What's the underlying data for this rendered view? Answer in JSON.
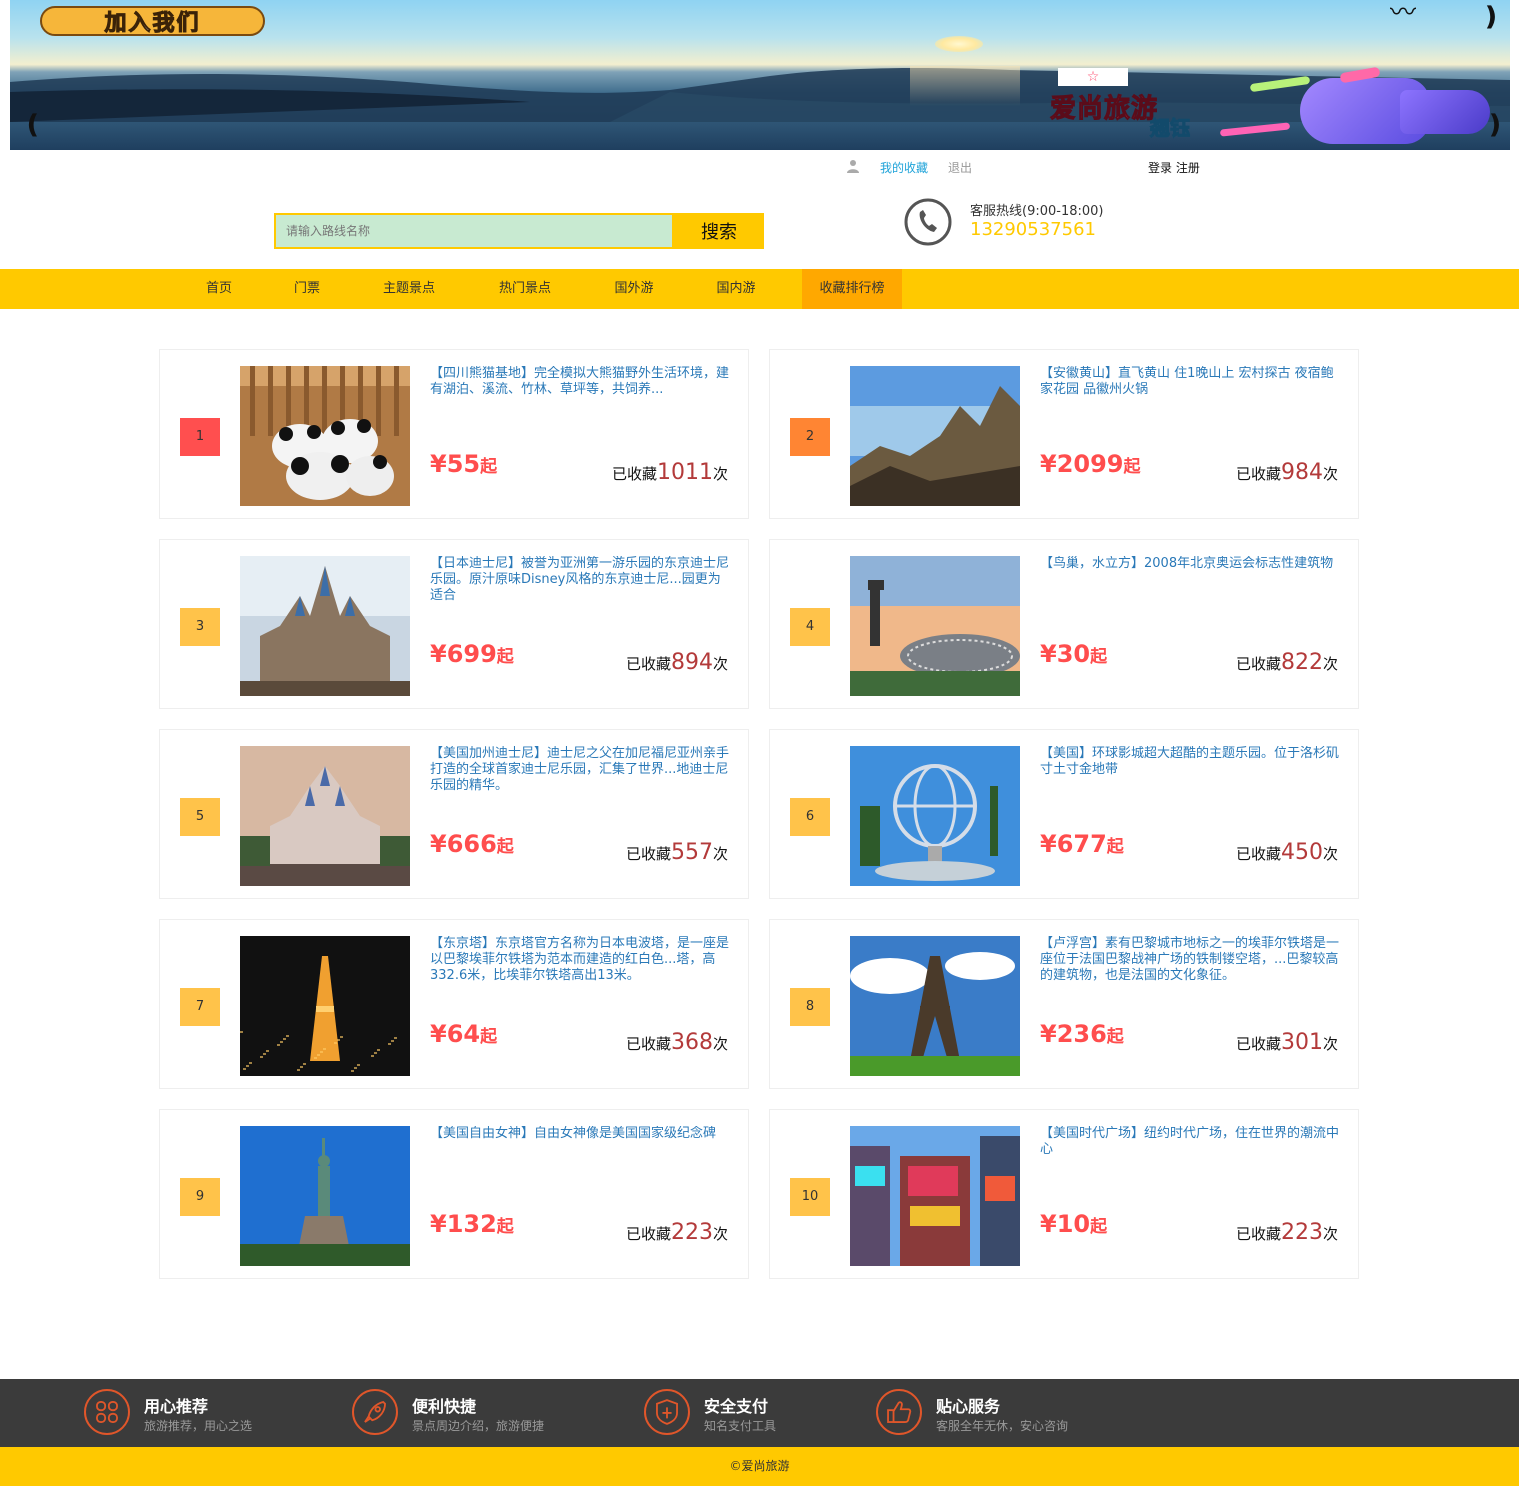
{
  "banner": {
    "join_text": "加入我们",
    "brand": "爱尚旅游",
    "sub": "翘钰",
    "star": "☆"
  },
  "toplinks": {
    "my_favorites": "我的收藏",
    "logout": "退出",
    "login_register": "登录 注册"
  },
  "search": {
    "placeholder": "请输入路线名称",
    "button": "搜索"
  },
  "hotline": {
    "label": "客服热线(9:00-18:00)",
    "number": "13290537561"
  },
  "nav": {
    "items": [
      "首页",
      "门票",
      "主题景点",
      "热门景点",
      "国外游",
      "国内游",
      "收藏排行榜"
    ],
    "active_index": 6
  },
  "ranking": [
    {
      "rank": "1",
      "title": "【四川熊猫基地】完全模拟大熊猫野外生活环境，建有湖泊、溪流、竹林、草坪等，共饲养...",
      "price": "¥55",
      "price_suffix": "起",
      "collect_prefix": "已收藏",
      "collect_count": "1011",
      "collect_suffix": "次",
      "image": "panda-photo",
      "rank_color": "#ff4f4f"
    },
    {
      "rank": "2",
      "title": "【安徽黄山】直飞黄山 住1晚山上 宏村探古 夜宿鲍家花园 品徽州火锅",
      "price": "¥2099",
      "price_suffix": "起",
      "collect_prefix": "已收藏",
      "collect_count": "984",
      "collect_suffix": "次",
      "image": "huangshan-photo",
      "rank_color": "#ff8533"
    },
    {
      "rank": "3",
      "title": "【日本迪士尼】被誉为亚洲第一游乐园的东京迪士尼乐园。原汁原味Disney风格的东京迪士尼...园更为适合",
      "price": "¥699",
      "price_suffix": "起",
      "collect_prefix": "已收藏",
      "collect_count": "894",
      "collect_suffix": "次",
      "image": "tokyo-disney-photo",
      "rank_color": "#ffc34a"
    },
    {
      "rank": "4",
      "title": "【鸟巢，水立方】2008年北京奥运会标志性建筑物",
      "price": "¥30",
      "price_suffix": "起",
      "collect_prefix": "已收藏",
      "collect_count": "822",
      "collect_suffix": "次",
      "image": "birds-nest-photo",
      "rank_color": "#ffc34a"
    },
    {
      "rank": "5",
      "title": "【美国加州迪士尼】迪士尼之父在加尼福尼亚州亲手打造的全球首家迪士尼乐园，汇集了世界...地迪士尼乐园的精华。",
      "price": "¥666",
      "price_suffix": "起",
      "collect_prefix": "已收藏",
      "collect_count": "557",
      "collect_suffix": "次",
      "image": "california-disney-photo",
      "rank_color": "#ffc34a"
    },
    {
      "rank": "6",
      "title": "【美国】环球影城超大超酷的主题乐园。位于洛杉矶寸土寸金地带",
      "price": "¥677",
      "price_suffix": "起",
      "collect_prefix": "已收藏",
      "collect_count": "450",
      "collect_suffix": "次",
      "image": "universal-globe-photo",
      "rank_color": "#ffc34a"
    },
    {
      "rank": "7",
      "title": "【东京塔】东京塔官方名称为日本电波塔，是一座是以巴黎埃菲尔铁塔为范本而建造的红白色...塔，高332.6米，比埃菲尔铁塔高出13米。",
      "price": "¥64",
      "price_suffix": "起",
      "collect_prefix": "已收藏",
      "collect_count": "368",
      "collect_suffix": "次",
      "image": "tokyo-tower-photo",
      "rank_color": "#ffc34a"
    },
    {
      "rank": "8",
      "title": "【卢浮宫】素有巴黎城市地标之一的埃菲尔铁塔是一座位于法国巴黎战神广场的铁制镂空塔，...巴黎较高的建筑物，也是法国的文化象征。",
      "price": "¥236",
      "price_suffix": "起",
      "collect_prefix": "已收藏",
      "collect_count": "301",
      "collect_suffix": "次",
      "image": "eiffel-tower-photo",
      "rank_color": "#ffc34a"
    },
    {
      "rank": "9",
      "title": "【美国自由女神】自由女神像是美国国家级纪念碑",
      "price": "¥132",
      "price_suffix": "起",
      "collect_prefix": "已收藏",
      "collect_count": "223",
      "collect_suffix": "次",
      "image": "statue-of-liberty-photo",
      "rank_color": "#ffc34a"
    },
    {
      "rank": "10",
      "title": "【美国时代广场】纽约时代广场，住在世界的潮流中心",
      "price": "¥10",
      "price_suffix": "起",
      "collect_prefix": "已收藏",
      "collect_count": "223",
      "collect_suffix": "次",
      "image": "times-square-photo",
      "rank_color": "#ffc34a"
    }
  ],
  "features": [
    {
      "title": "用心推荐",
      "desc": "旅游推荐，用心之选",
      "icon": "clover-icon"
    },
    {
      "title": "便利快捷",
      "desc": "景点周边介绍，旅游便捷",
      "icon": "rocket-icon"
    },
    {
      "title": "安全支付",
      "desc": "知名支付工具",
      "icon": "shield-icon"
    },
    {
      "title": "贴心服务",
      "desc": "客服全年无休，安心咨询",
      "icon": "thumbs-up-icon"
    }
  ],
  "footer": {
    "copyright": "©爱尚旅游"
  },
  "colors": {
    "accent": "#ffc900",
    "nav_active": "#ffa800",
    "price": "#ff4d4d",
    "link": "#2a79b8",
    "footer_dark": "#3b3b3b",
    "feature_icon": "#e0562a"
  }
}
